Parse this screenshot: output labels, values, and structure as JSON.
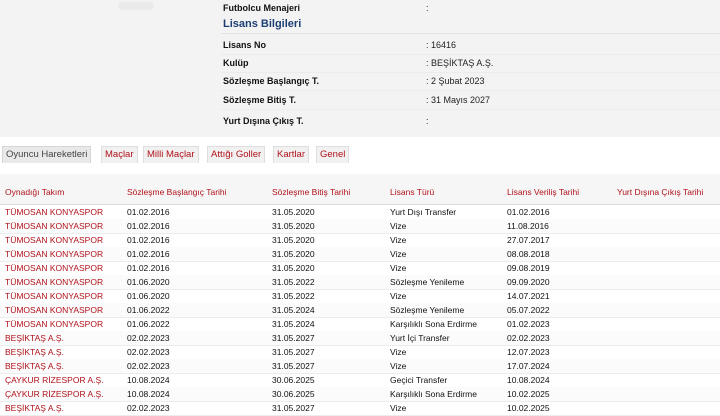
{
  "info": {
    "title": "Lisans Bilgileri",
    "rows": [
      {
        "label": "Futbolcu Menajeri",
        "value": ":"
      },
      {
        "label": "Lisans No",
        "value": ": 16416"
      },
      {
        "label": "Kulüp",
        "value": ": BEŞİKTAŞ A.Ş."
      },
      {
        "label": "Sözleşme Başlangıç T.",
        "value": ": 2 Şubat 2023"
      },
      {
        "label": "Sözleşme Bitiş T.",
        "value": ": 31 Mayıs 2027"
      },
      {
        "label": "Yurt Dışına Çıkış T.",
        "value": ":"
      }
    ]
  },
  "tabs": [
    {
      "label": "Oyuncu Hareketleri",
      "active": true
    },
    {
      "label": "Maçlar"
    },
    {
      "label": "Milli Maçlar"
    },
    {
      "label": "Attığı Goller"
    },
    {
      "label": "Kartlar"
    },
    {
      "label": "Genel"
    }
  ],
  "table": {
    "headers": [
      "Oynadığı Takım",
      "Sözleşme Başlangıç Tarihi",
      "Sözleşme Bitiş Tarihi",
      "Lisans Türü",
      "Lisans Veriliş Tarihi",
      "Yurt Dışına Çıkış Tarihi"
    ],
    "rows": [
      [
        "TÜMOSAN KONYASPOR",
        "01.02.2016",
        "31.05.2020",
        "Yurt Dışı Transfer",
        "01.02.2016",
        ""
      ],
      [
        "TÜMOSAN KONYASPOR",
        "01.02.2016",
        "31.05.2020",
        "Vize",
        "11.08.2016",
        ""
      ],
      [
        "TÜMOSAN KONYASPOR",
        "01.02.2016",
        "31.05.2020",
        "Vize",
        "27.07.2017",
        ""
      ],
      [
        "TÜMOSAN KONYASPOR",
        "01.02.2016",
        "31.05.2020",
        "Vize",
        "08.08.2018",
        ""
      ],
      [
        "TÜMOSAN KONYASPOR",
        "01.02.2016",
        "31.05.2020",
        "Vize",
        "09.08.2019",
        ""
      ],
      [
        "TÜMOSAN KONYASPOR",
        "01.06.2020",
        "31.05.2022",
        "Sözleşme Yenileme",
        "09.09.2020",
        ""
      ],
      [
        "TÜMOSAN KONYASPOR",
        "01.06.2020",
        "31.05.2022",
        "Vize",
        "14.07.2021",
        ""
      ],
      [
        "TÜMOSAN KONYASPOR",
        "01.06.2022",
        "31.05.2024",
        "Sözleşme Yenileme",
        "05.07.2022",
        ""
      ],
      [
        "TÜMOSAN KONYASPOR",
        "01.06.2022",
        "31.05.2024",
        "Karşılıklı Sona Erdirme",
        "01.02.2023",
        ""
      ],
      [
        "BEŞİKTAŞ A.Ş.",
        "02.02.2023",
        "31.05.2027",
        "Yurt İçi Transfer",
        "02.02.2023",
        ""
      ],
      [
        "BEŞİKTAŞ A.Ş.",
        "02.02.2023",
        "31.05.2027",
        "Vize",
        "12.07.2023",
        ""
      ],
      [
        "BEŞİKTAŞ A.Ş.",
        "02.02.2023",
        "31.05.2027",
        "Vize",
        "17.07.2024",
        ""
      ],
      [
        "ÇAYKUR RİZESPOR A.Ş.",
        "10.08.2024",
        "30.06.2025",
        "Geçici Transfer",
        "10.08.2024",
        ""
      ],
      [
        "ÇAYKUR RİZESPOR A.Ş.",
        "10.08.2024",
        "30.06.2025",
        "Karşılıklı Sona Erdirme",
        "10.02.2025",
        ""
      ],
      [
        "BEŞİKTAŞ A.Ş.",
        "02.02.2023",
        "31.05.2027",
        "Vize",
        "10.02.2025",
        ""
      ]
    ]
  }
}
